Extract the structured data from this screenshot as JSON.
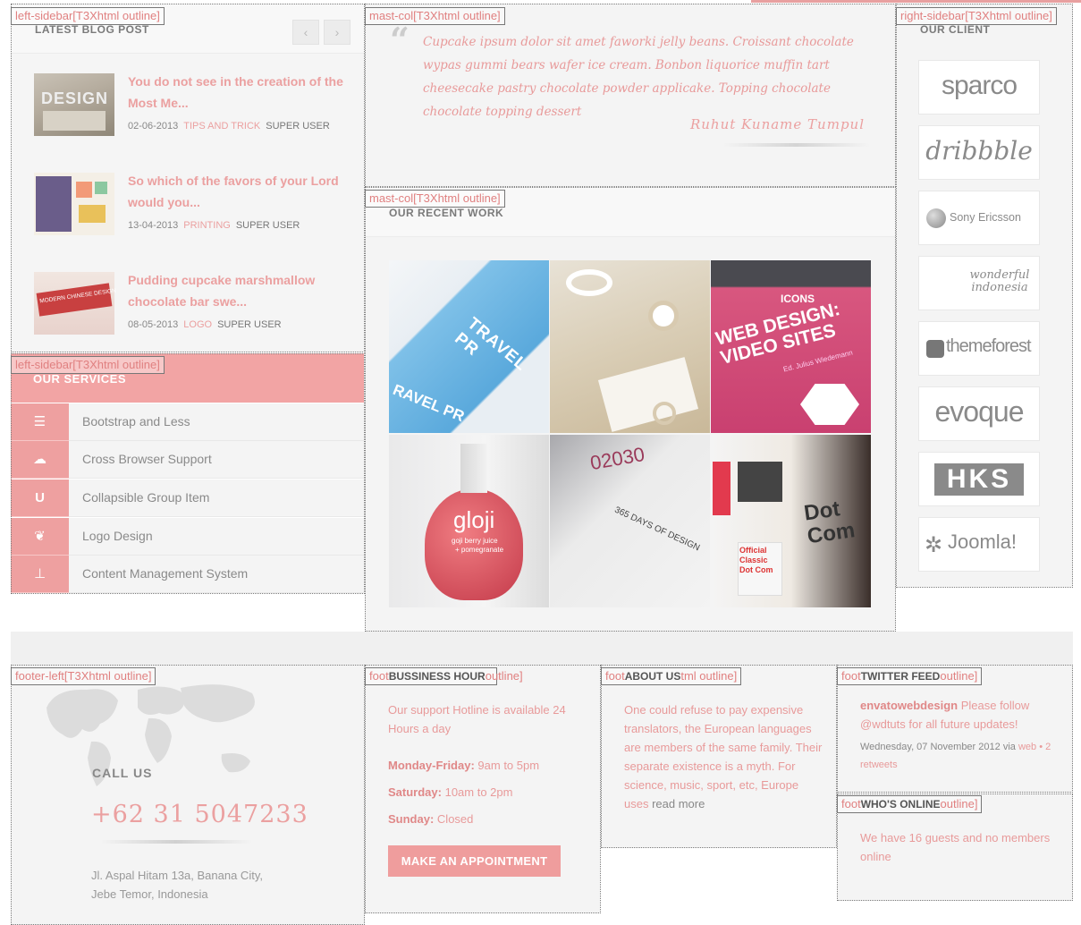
{
  "outline_labels": {
    "left_sidebar": "left-sidebar[T3Xhtml outline]",
    "mast_col": "mast-col[T3Xhtml outline]",
    "right_sidebar": "right-sidebar[T3Xhtml outline]",
    "footer_left": "footer-left[T3Xhtml outline]",
    "footer_partial": "foot",
    "footer_about_left": "foot",
    "footer_about_right": "tml outline]",
    "footer_twitter_left": "foot",
    "footer_twitter_right": "outline]",
    "footer_whos_left": "foot",
    "footer_whos_right": "outline]",
    "footer_business_right": "outline]"
  },
  "blog": {
    "title": "LATEST BLOG POST",
    "prev_icon": "‹",
    "next_icon": "›",
    "posts": [
      {
        "title": "You do not see in the creation of the Most Me...",
        "date": "02-06-2013",
        "category": "TIPS AND TRICK",
        "author": "SUPER USER"
      },
      {
        "title": "So which of the favors of your Lord would you...",
        "date": "13-04-2013",
        "category": "PRINTING",
        "author": "SUPER USER"
      },
      {
        "title": "Pudding cupcake marshmallow chocolate bar swe...",
        "date": "08-05-2013",
        "category": "LOGO",
        "author": "SUPER USER"
      }
    ],
    "thumb_texts": [
      "DESIGN",
      "",
      "MODERN CHINESE DESIGN"
    ]
  },
  "services": {
    "title": "OUR SERVICES",
    "items": [
      {
        "label": "Bootstrap and Less",
        "icon": "list-icon",
        "glyph": "☰"
      },
      {
        "label": "Cross Browser Support",
        "icon": "cloud-icon",
        "glyph": "☁"
      },
      {
        "label": "Collapsible Group Item",
        "icon": "magnet-icon",
        "glyph": "U"
      },
      {
        "label": "Logo Design",
        "icon": "leaf-icon",
        "glyph": "❦"
      },
      {
        "label": "Content Management System",
        "icon": "sitemap-icon",
        "glyph": "⊥"
      }
    ]
  },
  "testimonial": {
    "quote_mark": "“",
    "text": "Cupcake ipsum dolor sit amet faworki jelly beans. Croissant chocolate wypas gummi bears wafer ice cream. Bonbon liquorice muffin tart cheesecake pastry chocolate powder applicake. Topping chocolate chocolate topping dessert",
    "author": "Ruhut Kuname Tumpul"
  },
  "work": {
    "title": "OUR RECENT WORK",
    "tiles": [
      {
        "caption": "TRAVEL PR",
        "caption2": "RAVEL PR"
      },
      {
        "caption": ""
      },
      {
        "caption": "WEB DESIGN: VIDEO SITES",
        "caption2": "ICONS",
        "caption3": "Ed. Julius Wiedemann"
      },
      {
        "caption": "gloji",
        "caption2": "goji berry juice",
        "caption3": "+ pomegranate"
      },
      {
        "caption": "365 DAYS OF DESIGN",
        "caption2": "02030"
      },
      {
        "caption": "Dot Com",
        "caption2": "Official Classic Dot Com"
      }
    ]
  },
  "clients": {
    "title": "OUR CLIENT",
    "logos": [
      {
        "name": "sparco",
        "icon": "sparco-logo"
      },
      {
        "name": "dribbble",
        "icon": "dribbble-logo"
      },
      {
        "name": "Sony Ericsson",
        "icon": "sony-ericsson-logo"
      },
      {
        "name": "wonderful indonesia",
        "icon": "indonesia-logo"
      },
      {
        "name": "themeforest",
        "icon": "themeforest-logo"
      },
      {
        "name": "evoque",
        "icon": "evoque-logo"
      },
      {
        "name": "HKS",
        "icon": "hks-logo"
      },
      {
        "name": "Joomla!",
        "icon": "joomla-logo"
      }
    ]
  },
  "footer": {
    "call_us": "CALL US",
    "phone": "+62 31 5047233",
    "address_line1": "Jl. Aspal Hitam 13a, Banana City,",
    "address_line2": "Jebe Temor, Indonesia",
    "business": {
      "title": "BUSSINESS HOUR",
      "intro": "Our support Hotline is available 24 Hours a day",
      "hours": [
        {
          "day": "Monday-Friday:",
          "time": "9am to 5pm"
        },
        {
          "day": "Saturday:",
          "time": "10am to 2pm"
        },
        {
          "day": "Sunday:",
          "time": "Closed"
        }
      ],
      "button": "MAKE AN APPOINTMENT"
    },
    "about": {
      "title": "ABOUT US",
      "text": "One could refuse to pay expensive translators, the European languages are members of the same family. Their separate existence is a myth. For science, music, sport, etc, Europe uses",
      "read_more": "read more"
    },
    "twitter": {
      "title": "TWITTER FEED",
      "user": "envatowebdesign",
      "text": "Please follow",
      "mention": "@wdtuts",
      "text2": "for all future updates!",
      "date": "Wednesday, 07 November 2012",
      "via_word": "via",
      "via": "web",
      "retweets": "• 2 retweets"
    },
    "whos_online": {
      "title": "WHO'S ONLINE",
      "text": "We have 16 guests and no members online"
    }
  },
  "colors": {
    "accent": "#ef9d9d",
    "panel": "#f4f4f4",
    "outline_label": "#e08080"
  }
}
